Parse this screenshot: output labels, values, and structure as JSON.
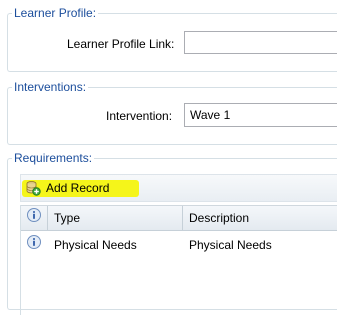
{
  "learner_profile": {
    "legend": "Learner Profile:",
    "link_label": "Learner Profile Link:",
    "link_value": ""
  },
  "interventions": {
    "legend": "Interventions:",
    "intervention_label": "Intervention:",
    "intervention_value": "Wave 1"
  },
  "requirements": {
    "legend": "Requirements:",
    "toolbar": {
      "add_record_label": "Add Record"
    },
    "grid": {
      "columns": [
        "Type",
        "Description"
      ],
      "rows": [
        {
          "type": "Physical Needs",
          "description": "Physical Needs"
        }
      ]
    }
  },
  "colors": {
    "legend_text": "#1c4e9c",
    "highlight": "#f5f51a",
    "border": "#d5dfe5"
  },
  "icons": {
    "add_record": "add-record-icon",
    "info": "info-icon"
  }
}
